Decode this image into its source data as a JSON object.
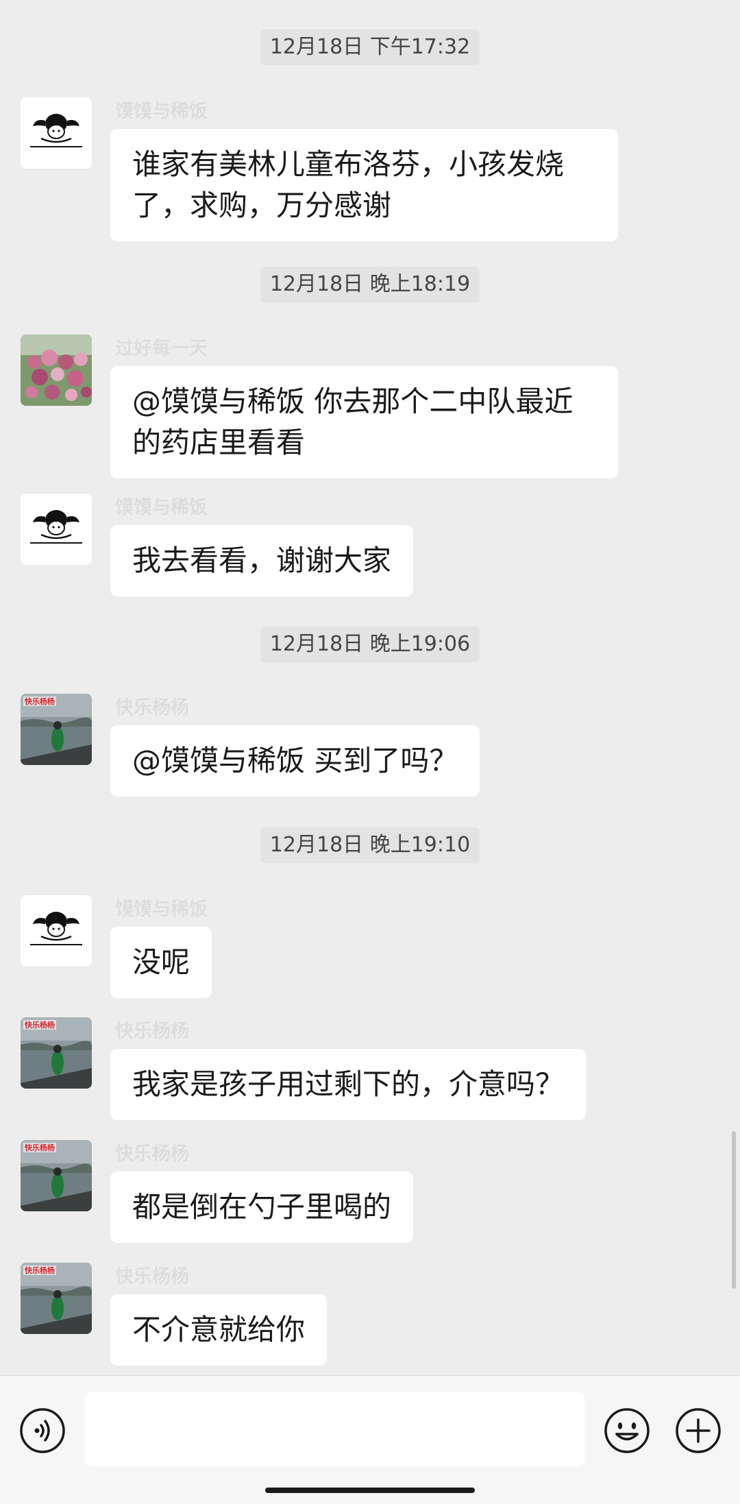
{
  "timestamps": [
    "12月18日 下午17:32",
    "12月18日 晚上18:19",
    "12月18日 晚上19:06",
    "12月18日 晚上19:10"
  ],
  "messages": [
    {
      "sender": "馍馍与稀饭",
      "text": "谁家有美林儿童布洛芬，小孩发烧了，求购，万分感谢"
    },
    {
      "sender": "过好每一天",
      "text": "@馍馍与稀饭  你去那个二中队最近的药店里看看"
    },
    {
      "sender": "馍馍与稀饭",
      "text": "我去看看，谢谢大家"
    },
    {
      "sender": "快乐杨杨",
      "text": "@馍馍与稀饭  买到了吗？"
    },
    {
      "sender": "馍馍与稀饭",
      "text": "没呢"
    },
    {
      "sender": "快乐杨杨",
      "text": "我家是孩子用过剩下的，介意吗？"
    },
    {
      "sender": "快乐杨杨",
      "text": "都是倒在勺子里喝的"
    },
    {
      "sender": "快乐杨杨",
      "text": "不介意就给你"
    }
  ],
  "avatar_badge_text": "快乐杨杨",
  "icons": {
    "voice": "voice-icon",
    "emoji": "emoji-icon",
    "plus": "plus-icon"
  },
  "colors": {
    "background": "#ededed",
    "bubble": "#ffffff",
    "sender_name": "#dcdcdc",
    "timestamp_bg": "#e3e3e3"
  }
}
